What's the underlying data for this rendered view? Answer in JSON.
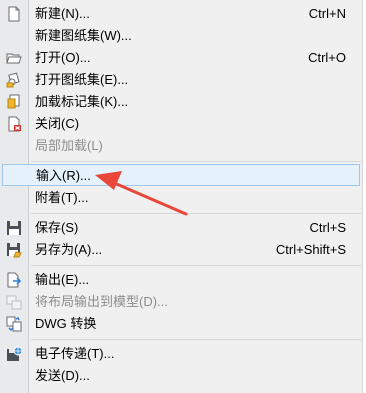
{
  "menu": {
    "items": [
      {
        "id": "new",
        "label": "新建(N)...",
        "shortcut": "Ctrl+N",
        "icon": "new-file-icon"
      },
      {
        "id": "new-sheetset",
        "label": "新建图纸集(W)...",
        "shortcut": "",
        "icon": ""
      },
      {
        "id": "open",
        "label": "打开(O)...",
        "shortcut": "Ctrl+O",
        "icon": "open-folder-icon"
      },
      {
        "id": "open-sheetset",
        "label": "打开图纸集(E)...",
        "shortcut": "",
        "icon": "open-sheetset-icon"
      },
      {
        "id": "load-markup",
        "label": "加载标记集(K)...",
        "shortcut": "",
        "icon": "markup-set-icon"
      },
      {
        "id": "close",
        "label": "关闭(C)",
        "shortcut": "",
        "icon": "close-file-icon"
      },
      {
        "id": "partial-load",
        "label": "局部加载(L)",
        "shortcut": "",
        "icon": ""
      },
      {
        "id": "import",
        "label": "输入(R)...",
        "shortcut": "",
        "icon": ""
      },
      {
        "id": "attach",
        "label": "附着(T)...",
        "shortcut": "",
        "icon": ""
      },
      {
        "id": "save",
        "label": "保存(S)",
        "shortcut": "Ctrl+S",
        "icon": "save-icon"
      },
      {
        "id": "save-as",
        "label": "另存为(A)...",
        "shortcut": "Ctrl+Shift+S",
        "icon": "save-as-icon"
      },
      {
        "id": "export",
        "label": "输出(E)...",
        "shortcut": "",
        "icon": "export-icon"
      },
      {
        "id": "export-layout",
        "label": "将布局输出到模型(D)...",
        "shortcut": "",
        "icon": "export-layout-icon"
      },
      {
        "id": "dwg-convert",
        "label": "DWG 转换",
        "shortcut": "",
        "icon": "dwg-convert-icon"
      },
      {
        "id": "etransmit",
        "label": "电子传递(T)...",
        "shortcut": "",
        "icon": "etransmit-icon"
      },
      {
        "id": "send",
        "label": "发送(D)...",
        "shortcut": "",
        "icon": ""
      }
    ],
    "disabled": [
      "partial-load",
      "export-layout"
    ],
    "highlighted": "import"
  },
  "colors": {
    "menu_bg": "#f0f0f0",
    "gutter_bg": "#e9eaec",
    "highlight_bg": "#e5f1fb",
    "highlight_border": "#9fc7ec",
    "disabled_text": "#8d8d8d",
    "annotation_arrow": "#e8473a"
  }
}
